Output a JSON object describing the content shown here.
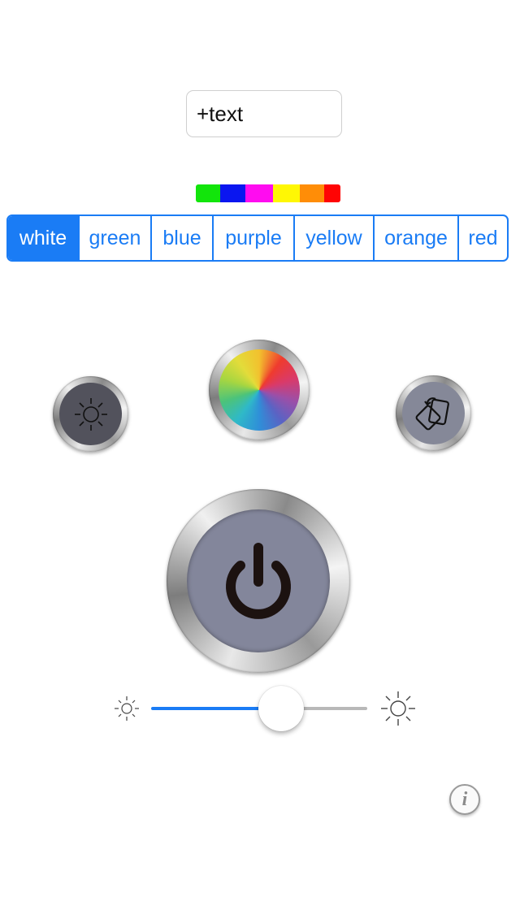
{
  "text_button": {
    "label": "+text"
  },
  "color_strip": [
    "#12e50b",
    "#0a16f0",
    "#ff0cf0",
    "#fff704",
    "#ff8d07",
    "#ff0404"
  ],
  "segments": [
    {
      "label": "white",
      "selected": true
    },
    {
      "label": "green",
      "selected": false
    },
    {
      "label": "blue",
      "selected": false
    },
    {
      "label": "purple",
      "selected": false
    },
    {
      "label": "yellow",
      "selected": false
    },
    {
      "label": "orange",
      "selected": false
    },
    {
      "label": "red",
      "selected": false
    }
  ],
  "accent_color": "#1a7cf5",
  "buttons": {
    "brightness_mode": {
      "icon": "sun-icon"
    },
    "color_wheel": {
      "icon": "color-wheel-icon"
    },
    "flip": {
      "icon": "flip-cards-icon"
    },
    "power": {
      "icon": "power-icon"
    }
  },
  "brightness_slider": {
    "value": 0.6,
    "min_icon": "sun-small-icon",
    "max_icon": "sun-large-icon"
  },
  "info_button": {
    "label": "i",
    "icon": "info-icon"
  }
}
